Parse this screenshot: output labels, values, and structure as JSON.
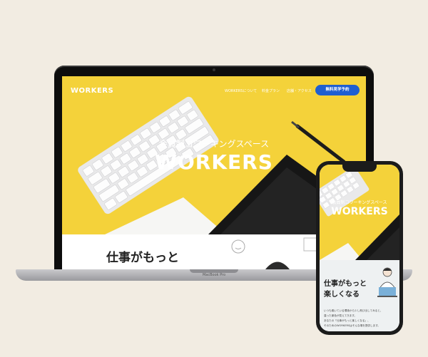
{
  "site": {
    "logo": "WORKERS",
    "nav": [
      "WORKERSについて",
      "料金プラン",
      "店舗・アクセス"
    ],
    "cta": "無料見学予約",
    "hero_subtitle": "会員制コワーキングスペース",
    "hero_title": "WORKERS",
    "section_heading": "仕事がもっと"
  },
  "laptop": {
    "brand": "MacBook Pro"
  },
  "phone": {
    "hero_subtitle": "会員制コワーキングスペース",
    "hero_title": "WORKERS",
    "heading_line1": "仕事がもっと",
    "heading_line2": "楽しくなる",
    "body": [
      "いつも働いている環境から少し飛び出してみると、",
      "違った景色が見えてきます。",
      "あなたの「仕事がもっと楽しくなる」、",
      "そのためのWORKERSはそんな場を提供します。"
    ]
  },
  "colors": {
    "background": "#f2ece2",
    "hero_yellow": "#f4d23a",
    "cta_blue": "#1f5fd0"
  }
}
